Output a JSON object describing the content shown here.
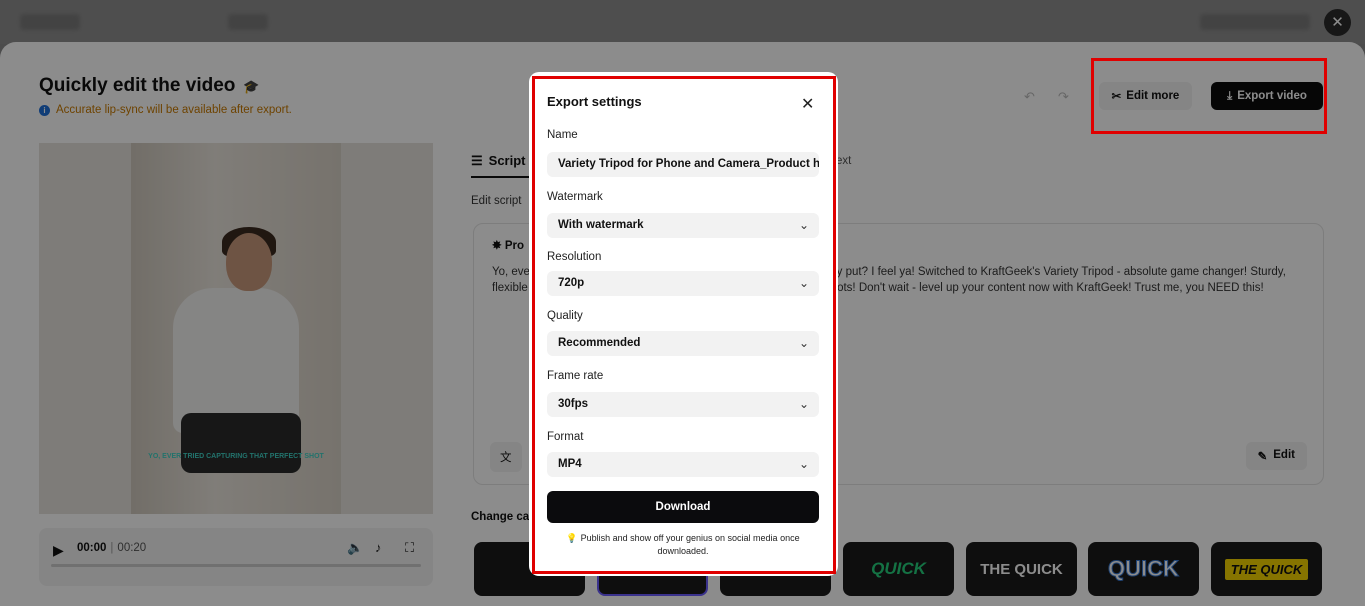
{
  "header": {
    "title": "Quickly edit the video",
    "notice": "Accurate lip-sync will be available after export.",
    "edit_more_label": "Edit more",
    "export_video_label": "Export video"
  },
  "player": {
    "current_time": "00:00",
    "total_time": "00:20",
    "subtitle": "YO, EVER TRIED CAPTURING THAT PERFECT SHOT"
  },
  "script_panel": {
    "tab_script": "Script",
    "tab_text": "ext",
    "edit_script_label": "Edit script",
    "pro_label": "Pro",
    "script_text_line1": "Yo, eve                                                                                              ay put? I feel ya! Switched to KraftGeek's Variety Tripod - absolute game changer! Sturdy,",
    "script_text_line2": "flexible                                                                                             shots! Don't wait - level up your content now with KraftGeek! Trust me, you NEED this!",
    "edit_button": "Edit",
    "change_label": "Change ca"
  },
  "caption_styles": [
    "QUICK",
    "THE QUICK",
    "QUICK",
    "THE QUICK"
  ],
  "modal": {
    "title": "Export settings",
    "fields": [
      {
        "label": "Name",
        "value": "Variety Tripod for Phone and Camera_Product h"
      },
      {
        "label": "Watermark",
        "value": "With watermark"
      },
      {
        "label": "Resolution",
        "value": "720p"
      },
      {
        "label": "Quality",
        "value": "Recommended"
      },
      {
        "label": "Frame rate",
        "value": "30fps"
      },
      {
        "label": "Format",
        "value": "MP4"
      }
    ],
    "download_label": "Download",
    "tip": "Publish and show off your genius on social media once downloaded."
  },
  "colors": {
    "highlight": "#e00000",
    "notice": "#c97a00",
    "primary_button": "#0b0b0d"
  }
}
